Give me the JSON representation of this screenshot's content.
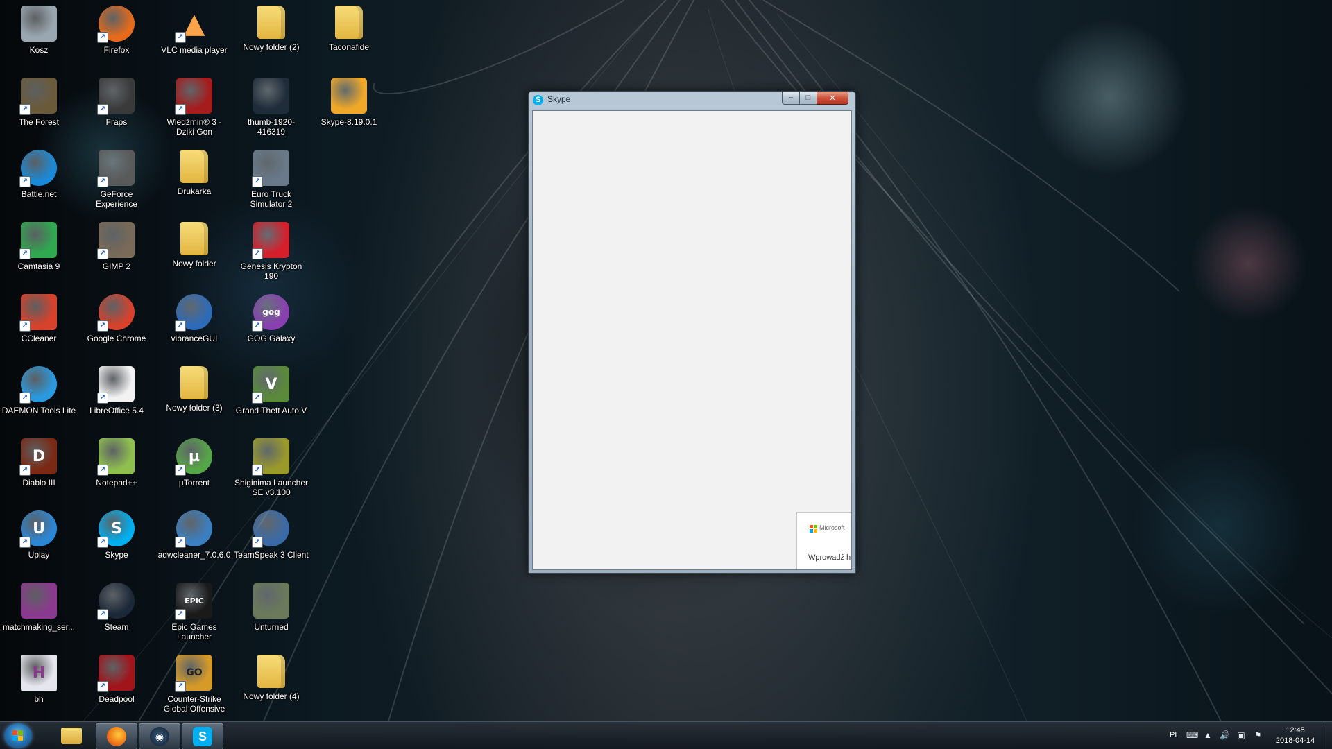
{
  "desktop": {
    "icons": [
      {
        "label": "Kosz",
        "icon": "recycle-bin-icon",
        "color": "#9aa7b0"
      },
      {
        "label": "The Forest",
        "icon": "the-forest-icon",
        "color": "#6b5a3a"
      },
      {
        "label": "Battle.net",
        "icon": "battle-net-icon",
        "color": "#1a8ad8"
      },
      {
        "label": "Camtasia 9",
        "icon": "camtasia-icon",
        "color": "#2fa84f"
      },
      {
        "label": "CCleaner",
        "icon": "ccleaner-icon",
        "color": "#d8412b"
      },
      {
        "label": "DAEMON Tools Lite",
        "icon": "daemon-tools-icon",
        "color": "#2a9ae0"
      },
      {
        "label": "Diablo III",
        "icon": "diablo-icon",
        "color": "#7a2a14"
      },
      {
        "label": "Uplay",
        "icon": "uplay-icon",
        "color": "#2c86d6"
      },
      {
        "label": "matchmaking_ser...",
        "icon": "winrar-archive-icon",
        "color": "#8a3a8e"
      },
      {
        "label": "bh",
        "icon": "document-h-icon",
        "color": "#e6e6ee"
      },
      {
        "label": "Firefox",
        "icon": "firefox-icon",
        "color": "#e66a1a"
      },
      {
        "label": "Fraps",
        "icon": "fraps-icon",
        "color": "#3a3a3a"
      },
      {
        "label": "GeForce Experience",
        "icon": "geforce-experience-icon",
        "color": "#5a5a5a"
      },
      {
        "label": "GIMP 2",
        "icon": "gimp-icon",
        "color": "#7a6a58"
      },
      {
        "label": "Google Chrome",
        "icon": "chrome-icon",
        "color": "#d8412b"
      },
      {
        "label": "LibreOffice 5.4",
        "icon": "libreoffice-icon",
        "color": "#f2f2f2"
      },
      {
        "label": "Notepad++",
        "icon": "notepad-plus-plus-icon",
        "color": "#8fbf4f"
      },
      {
        "label": "Skype",
        "icon": "skype-icon",
        "color": "#00aff0"
      },
      {
        "label": "Steam",
        "icon": "steam-icon",
        "color": "#1b2838"
      },
      {
        "label": "Deadpool",
        "icon": "deadpool-icon",
        "color": "#a0141a"
      },
      {
        "label": "VLC media player",
        "icon": "vlc-icon",
        "color": "#f07e14"
      },
      {
        "label": "Wiedźmin® 3 - Dziki Gon",
        "icon": "witcher-icon",
        "color": "#a61c1c"
      },
      {
        "label": "Drukarka",
        "icon": "folder-icon",
        "color": "#e9c458"
      },
      {
        "label": "Nowy folder",
        "icon": "folder-icon",
        "color": "#e9c458"
      },
      {
        "label": "vibranceGUI",
        "icon": "vibrancegui-icon",
        "color": "#2d6bb8"
      },
      {
        "label": "Nowy folder (3)",
        "icon": "folder-icon",
        "color": "#e9c458"
      },
      {
        "label": "µTorrent",
        "icon": "utorrent-icon",
        "color": "#55a646"
      },
      {
        "label": "adwcleaner_7.0.6.0",
        "icon": "adwcleaner-icon",
        "color": "#3a7fc2"
      },
      {
        "label": "Epic Games Launcher",
        "icon": "epic-games-icon",
        "color": "#1a1a1a"
      },
      {
        "label": "Counter-Strike Global Offensive",
        "icon": "csgo-icon",
        "color": "#d59a28"
      },
      {
        "label": "Nowy folder (2)",
        "icon": "folder-icon",
        "color": "#e9c458"
      },
      {
        "label": "thumb-1920-416319",
        "icon": "image-thumbnail-icon",
        "color": "#1f2c3a"
      },
      {
        "label": "Euro Truck Simulator 2",
        "icon": "euro-truck-icon",
        "color": "#6a7a8a"
      },
      {
        "label": "Genesis Krypton 190",
        "icon": "genesis-krypton-icon",
        "color": "#d51f2b"
      },
      {
        "label": "GOG Galaxy",
        "icon": "gog-galaxy-icon",
        "color": "#8a3fb0"
      },
      {
        "label": "Grand Theft Auto V",
        "icon": "gta-v-icon",
        "color": "#5a8a3a"
      },
      {
        "label": "Shiginima Launcher SE v3.100",
        "icon": "minecraft-block-icon",
        "color": "#9a9a2a"
      },
      {
        "label": "TeamSpeak 3 Client",
        "icon": "teamspeak-icon",
        "color": "#3a6aa8"
      },
      {
        "label": "Unturned",
        "icon": "unturned-icon",
        "color": "#6a7a5a"
      },
      {
        "label": "Nowy folder (4)",
        "icon": "folder-icon",
        "color": "#e9c458"
      },
      {
        "label": "Taconafide",
        "icon": "folder-icon",
        "color": "#e9c458"
      },
      {
        "label": "Skype-8.19.0.1",
        "icon": "skype-installer-icon",
        "color": "#f0a828"
      }
    ]
  },
  "skype_window": {
    "title": "Skype",
    "buttons": {
      "minimize": "–",
      "maximize": "□",
      "close": "✕"
    },
    "microsoft_brand": "Microsoft",
    "sign_in_prompt": "Wprowadź h"
  },
  "taskbar": {
    "apps": [
      {
        "name": "File Explorer",
        "icon": "file-explorer-icon"
      },
      {
        "name": "Firefox",
        "icon": "firefox-icon"
      },
      {
        "name": "Steam",
        "icon": "steam-icon"
      },
      {
        "name": "Skype",
        "icon": "skype-icon"
      }
    ],
    "tray": {
      "language": "PL",
      "time": "12:45",
      "date": "2018-04-14"
    }
  },
  "colors": {
    "skype_blue": "#00aff0",
    "window_frame": "#a7b8c8",
    "close_button": "#c8402a",
    "taskbar": "#1c242c"
  }
}
